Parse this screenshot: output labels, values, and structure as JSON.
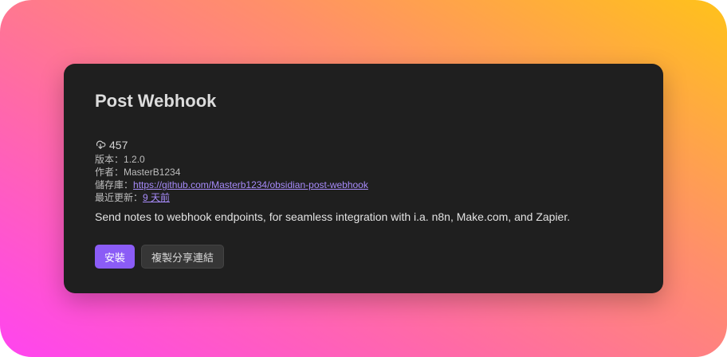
{
  "plugin": {
    "title": "Post Webhook",
    "downloads": "457",
    "version_label": "版本：",
    "version": "1.2.0",
    "author_label": "作者：",
    "author": "MasterB1234",
    "repo_label": "儲存庫：",
    "repo_url": "https://github.com/Masterb1234/obsidian-post-webhook",
    "updated_label": "最近更新：",
    "updated": "9 天前",
    "description": "Send notes to webhook endpoints, for seamless integration with i.a. n8n, Make.com, and Zapier."
  },
  "actions": {
    "install_label": "安裝",
    "copy_link_label": "複製分享連結"
  },
  "icons": {
    "downloads": "download-cloud-icon"
  },
  "colors": {
    "accent": "#8b5cf6",
    "link": "#a78bfa",
    "card_bg": "#1f1f1f"
  }
}
